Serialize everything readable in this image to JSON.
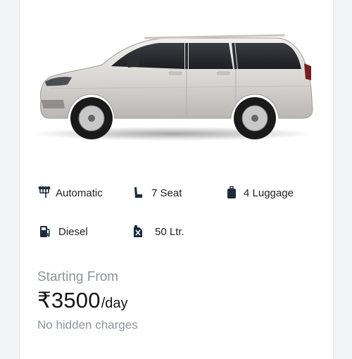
{
  "specs": {
    "transmission": {
      "label": "Automatic",
      "icon": "gear-shift-icon"
    },
    "seats": {
      "label": "7 Seat",
      "icon": "car-seat-icon"
    },
    "luggage": {
      "label": "4 Luggage",
      "icon": "luggage-icon"
    },
    "fuel": {
      "label": "Diesel",
      "icon": "fuel-pump-icon"
    },
    "tank": {
      "label": "50 Ltr.",
      "icon": "fuel-can-icon"
    }
  },
  "pricing": {
    "starting_label": "Starting From",
    "amount": "₹3500",
    "unit": "/day",
    "note": "No hidden charges"
  },
  "colors": {
    "icon": "#1e2b3c",
    "muted": "#8f939c",
    "car_body": "#d8d6d2"
  }
}
